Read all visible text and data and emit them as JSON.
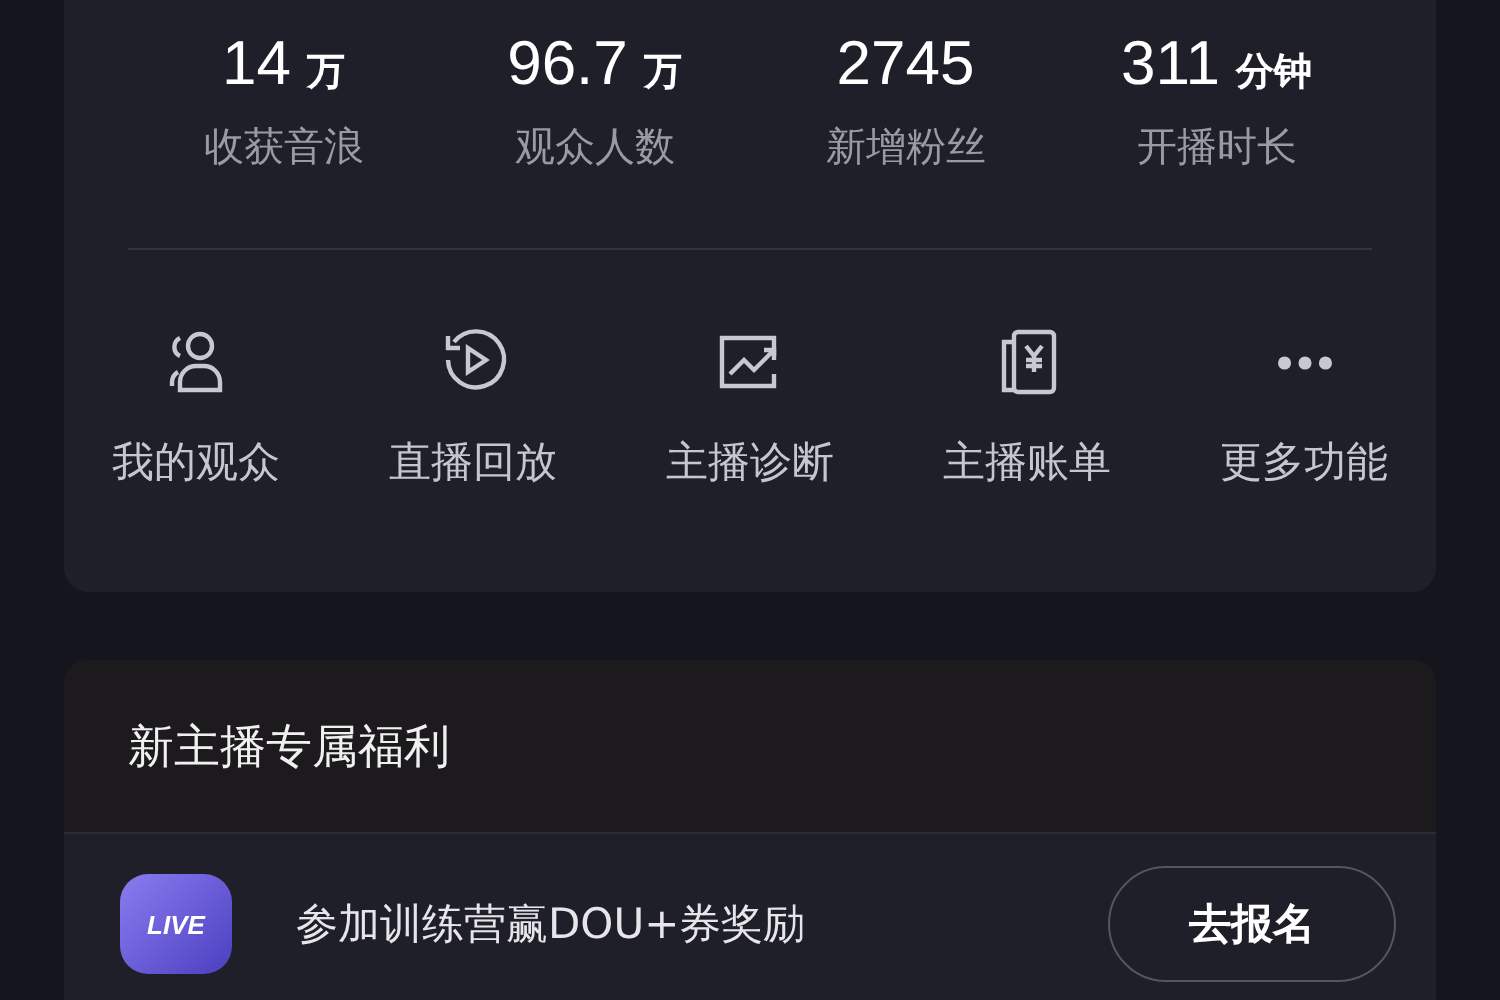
{
  "stats": [
    {
      "value": "14",
      "unit": "万",
      "label": "收获音浪"
    },
    {
      "value": "96.7",
      "unit": "万",
      "label": "观众人数"
    },
    {
      "value": "2745",
      "label": "新增粉丝"
    },
    {
      "value": "311",
      "unit": "分钟",
      "label": "开播时长"
    }
  ],
  "tools": [
    {
      "kind": "audience",
      "label": "我的观众"
    },
    {
      "kind": "replay",
      "label": "直播回放"
    },
    {
      "kind": "diagnosis",
      "label": "主播诊断"
    },
    {
      "kind": "bill",
      "label": "主播账单"
    },
    {
      "kind": "more",
      "label": "更多功能"
    }
  ],
  "benefits": {
    "title": "新主播专属福利",
    "items": [
      {
        "badge": "LIVE",
        "text": "参加训练营赢DOU+券奖励",
        "button": "去报名"
      }
    ]
  }
}
